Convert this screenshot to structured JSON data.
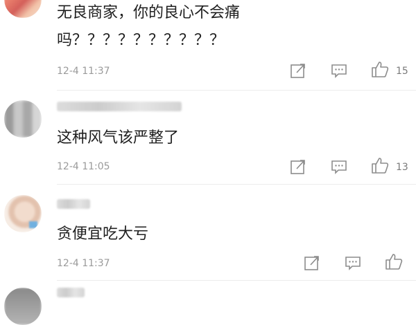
{
  "comments": [
    {
      "text_line1": "无良商家，你的良心不会痛",
      "text_line2": "吗？？？？？？？？？？",
      "time": "12-4 11:37",
      "likes": "15",
      "avatar_color": "#e8927a"
    },
    {
      "text": "这种风气该严整了",
      "time": "12-4 11:05",
      "likes": "13",
      "avatar_color": "#bdbdbd"
    },
    {
      "text": "贪便宜吃大亏",
      "time": "12-4 11:37",
      "likes": "",
      "avatar_color": "#e6cdbd"
    }
  ],
  "icons": {
    "share": "share-edit-icon",
    "reply": "comment-bubble-icon",
    "like": "thumbs-up-icon"
  },
  "colors": {
    "text": "#1f1f1f",
    "meta": "#9a9a9a",
    "icon": "#8c8c8c"
  }
}
